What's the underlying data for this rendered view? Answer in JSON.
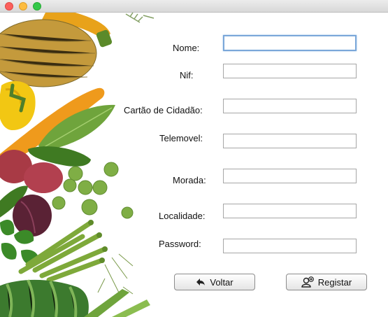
{
  "form": {
    "fields": [
      {
        "label": "Nome:",
        "value": ""
      },
      {
        "label": "Nif:",
        "value": ""
      },
      {
        "label": "Cartão de Cidadão:",
        "value": ""
      },
      {
        "label": "Telemovel:",
        "value": ""
      },
      {
        "label": "Morada:",
        "value": ""
      },
      {
        "label": "Localidade:",
        "value": ""
      },
      {
        "label": "Password:",
        "value": ""
      }
    ]
  },
  "buttons": {
    "back_label": "Voltar",
    "back_icon": "arrow-back-icon",
    "register_label": "Registar",
    "register_icon": "add-user-icon"
  },
  "colors": {
    "focus_border": "#7aa7d9",
    "button_border": "#8c8c8c"
  }
}
